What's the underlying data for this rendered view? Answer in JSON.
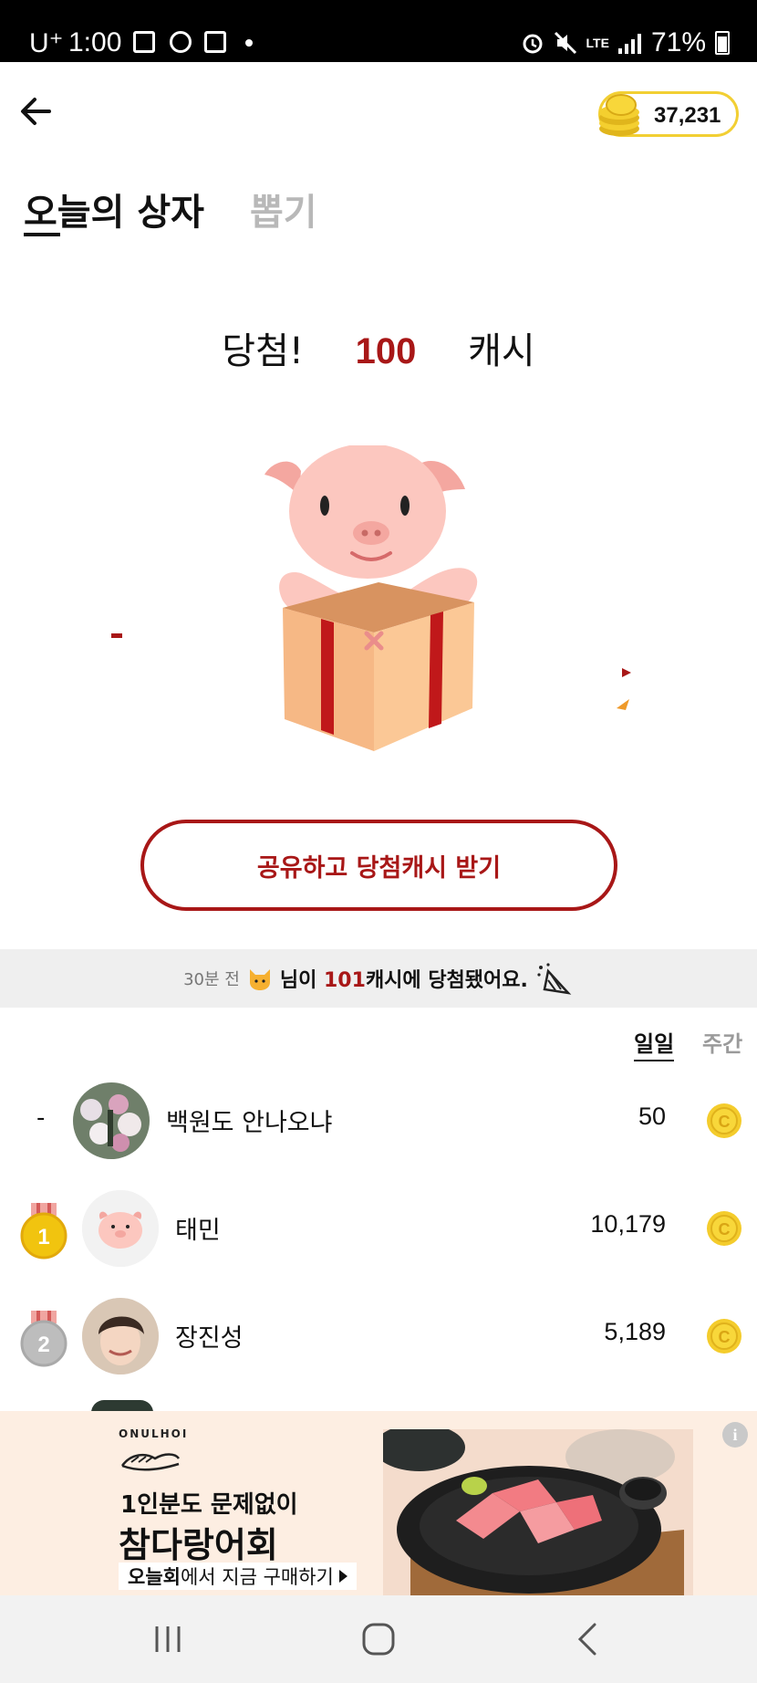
{
  "status_bar": {
    "carrier": "U⁺",
    "time": "1:00",
    "network": "LTE",
    "battery": "71%"
  },
  "header": {
    "coin_balance": "37,231"
  },
  "tabs": {
    "today_box": "오늘의 상자",
    "draw": "뽑기"
  },
  "result": {
    "prefix": "당첨!",
    "amount": "100",
    "unit": "캐시"
  },
  "share_button": "공유하고 당첨캐시 받기",
  "notice": {
    "ago": "30분 전",
    "msg_before": "님이 ",
    "amount": "101",
    "msg_after": "캐시에 당첨됐어요."
  },
  "period": {
    "daily": "일일",
    "weekly": "주간"
  },
  "ranking": [
    {
      "rank": "-",
      "name": "백원도 안나오냐",
      "score": "50"
    },
    {
      "rank": "1",
      "name": "태민",
      "score": "10,179"
    },
    {
      "rank": "2",
      "name": "장진성",
      "score": "5,189"
    }
  ],
  "ad": {
    "brand": "ONULHOI",
    "line1": "1인분도 문제없이",
    "line2": "참다랑어회",
    "cta_bold": "오늘회",
    "cta_rest": "에서 지금 구매하기",
    "info": "i"
  },
  "colors": {
    "accent_red": "#a81717",
    "coin_gold": "#f2cf33",
    "notice_bg": "#efefef",
    "ad_bg": "#fdeee2"
  },
  "icons": {
    "back": "arrow-left-icon",
    "coin": "coin-icon",
    "nav_recent": "recent-apps-icon",
    "nav_home": "home-icon",
    "nav_back": "chevron-left-icon"
  }
}
